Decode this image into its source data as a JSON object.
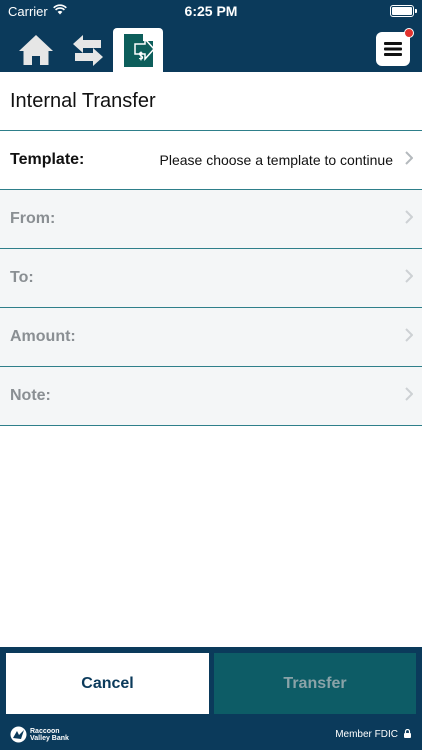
{
  "status_bar": {
    "carrier": "Carrier",
    "time": "6:25 PM"
  },
  "nav": {
    "home_icon": "home-icon",
    "transfer_icon": "transfer-arrows-icon",
    "active_icon": "money-transfer-icon",
    "menu_icon": "hamburger-menu-icon",
    "notification_color": "#e2312d"
  },
  "page": {
    "title": "Internal Transfer"
  },
  "form": {
    "rows": [
      {
        "label": "Template:",
        "value": "Please choose a template to continue"
      },
      {
        "label": "From:",
        "value": ""
      },
      {
        "label": "To:",
        "value": ""
      },
      {
        "label": "Amount:",
        "value": ""
      },
      {
        "label": "Note:",
        "value": ""
      }
    ]
  },
  "actions": {
    "cancel_label": "Cancel",
    "transfer_label": "Transfer"
  },
  "footer": {
    "logo_line1": "Raccoon",
    "logo_line2": "Valley Bank",
    "fdic": "Member FDIC"
  },
  "colors": {
    "brand": "#0b3a5b",
    "accent": "#2e7f8a",
    "transfer_button": "#0d5c66"
  }
}
